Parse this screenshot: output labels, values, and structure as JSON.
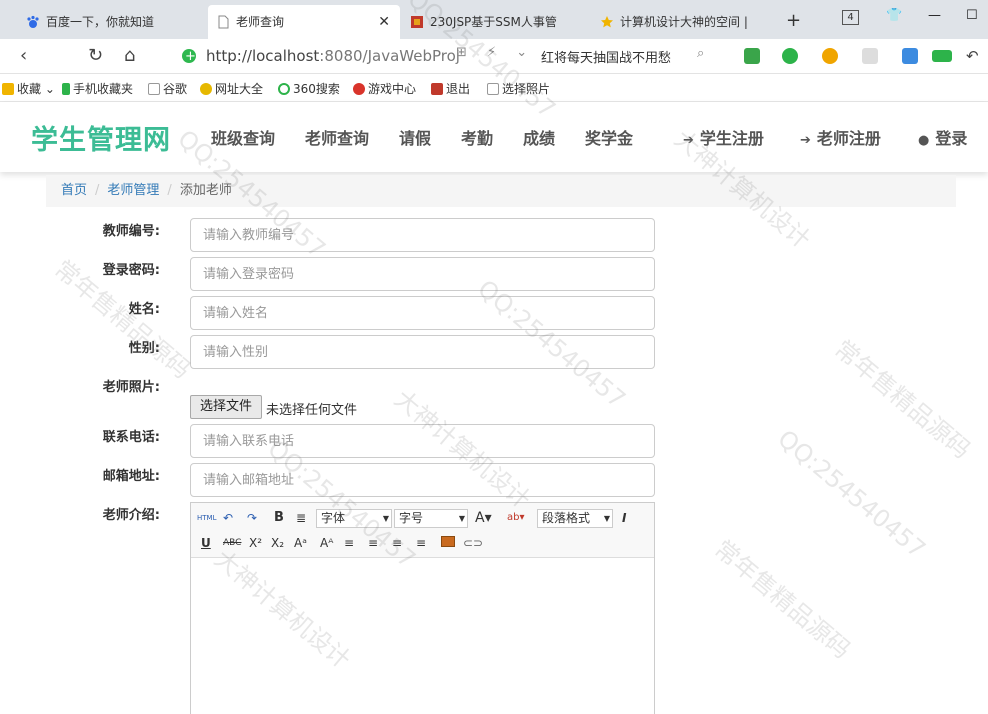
{
  "browser": {
    "tabs": [
      {
        "label": "百度一下，你就知道",
        "active": false
      },
      {
        "label": "老师查询",
        "active": true
      },
      {
        "label": "230JSP基于SSM人事管",
        "active": false
      },
      {
        "label": "计算机设计大神的空间 |",
        "active": false
      }
    ],
    "tab_count": "4",
    "url_host": "http://localhost",
    "url_rest": ":8080/JavaWebProj",
    "search_text": "红将每天抽国战不用愁",
    "bookmarks": [
      "收藏",
      "手机收藏夹",
      "谷歌",
      "网址大全",
      "360搜索",
      "游戏中心",
      "退出",
      "选择照片"
    ]
  },
  "site": {
    "logo": "学生管理网",
    "nav": [
      "班级查询",
      "老师查询",
      "请假",
      "考勤",
      "成绩",
      "奖学金"
    ],
    "right_nav": [
      "学生注册",
      "老师注册",
      "登录"
    ]
  },
  "breadcrumb": {
    "home": "首页",
    "section": "老师管理",
    "current": "添加老师"
  },
  "form": {
    "teacher_id_label": "教师编号:",
    "teacher_id_placeholder": "请输入教师编号",
    "password_label": "登录密码:",
    "password_placeholder": "请输入登录密码",
    "name_label": "姓名:",
    "name_placeholder": "请输入姓名",
    "gender_label": "性别:",
    "gender_placeholder": "请输入性别",
    "photo_label": "老师照片:",
    "file_button": "选择文件",
    "file_status": "未选择任何文件",
    "phone_label": "联系电话:",
    "phone_placeholder": "请输入联系电话",
    "email_label": "邮箱地址:",
    "email_placeholder": "请输入邮箱地址",
    "intro_label": "老师介绍:"
  },
  "editor": {
    "html_btn": "HTML",
    "font_select": "字体",
    "size_select": "字号",
    "format_select": "段落格式"
  },
  "watermark": {
    "text1": "QQ:254540457",
    "text2": "大神计算机设计",
    "text3": "常年售精品源码"
  },
  "colors": {
    "logo": "#3cbc95",
    "link": "#337ab7"
  }
}
